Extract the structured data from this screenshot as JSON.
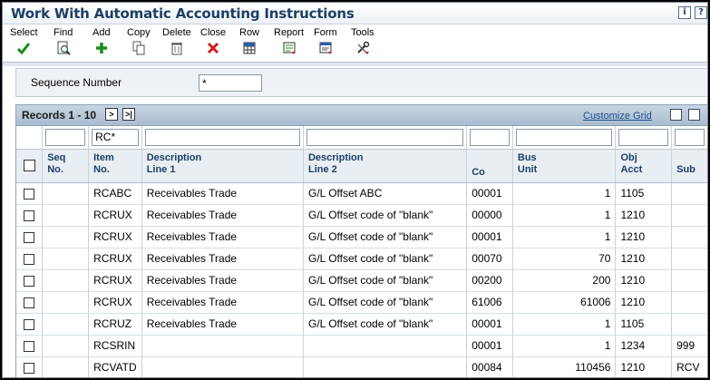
{
  "window": {
    "title": "Work With Automatic Accounting Instructions"
  },
  "toolbar": {
    "select": "Select",
    "find": "Find",
    "add": "Add",
    "copy": "Copy",
    "delete": "Delete",
    "close": "Close",
    "row": "Row",
    "report": "Report",
    "form": "Form",
    "tools": "Tools"
  },
  "colors": {
    "title": "#1d3f66",
    "link": "#1d4f91",
    "ok_green": "#1a8a1a",
    "close_red": "#d0201e"
  },
  "query": {
    "label": "Sequence Number",
    "value": "*"
  },
  "grid": {
    "records_label": "Records 1 - 10",
    "customize_label": "Customize Grid",
    "filter_values": [
      "",
      "RC*",
      "",
      "",
      "",
      "",
      "",
      ""
    ],
    "headers": {
      "seq_1": "Seq",
      "seq_2": "No.",
      "item_1": "Item",
      "item_2": "No.",
      "desc1_1": "Description",
      "desc1_2": "Line 1",
      "desc2_1": "Description",
      "desc2_2": "Line 2",
      "co": "Co",
      "bu_1": "Bus",
      "bu_2": "Unit",
      "obj_1": "Obj",
      "obj_2": "Acct",
      "sub": "Sub"
    },
    "rows": [
      {
        "seq": "",
        "item": "RCABC",
        "desc1": "Receivables Trade",
        "desc2": "G/L Offset ABC",
        "co": "00001",
        "bu": "1",
        "obj": "1105",
        "sub": ""
      },
      {
        "seq": "",
        "item": "RCRUX",
        "desc1": "Receivables Trade",
        "desc2": "G/L Offset code of \"blank\"",
        "co": "00000",
        "bu": "1",
        "obj": "1210",
        "sub": ""
      },
      {
        "seq": "",
        "item": "RCRUX",
        "desc1": "Receivables Trade",
        "desc2": "G/L Offset code of \"blank\"",
        "co": "00001",
        "bu": "1",
        "obj": "1210",
        "sub": ""
      },
      {
        "seq": "",
        "item": "RCRUX",
        "desc1": "Receivables Trade",
        "desc2": "G/L Offset code of \"blank\"",
        "co": "00070",
        "bu": "70",
        "obj": "1210",
        "sub": ""
      },
      {
        "seq": "",
        "item": "RCRUX",
        "desc1": "Receivables Trade",
        "desc2": "G/L Offset code of \"blank\"",
        "co": "00200",
        "bu": "200",
        "obj": "1210",
        "sub": ""
      },
      {
        "seq": "",
        "item": "RCRUX",
        "desc1": "Receivables Trade",
        "desc2": "G/L Offset code of \"blank\"",
        "co": "61006",
        "bu": "61006",
        "obj": "1210",
        "sub": ""
      },
      {
        "seq": "",
        "item": "RCRUZ",
        "desc1": "Receivables Trade",
        "desc2": "G/L Offset code of \"blank\"",
        "co": "00001",
        "bu": "1",
        "obj": "1105",
        "sub": ""
      },
      {
        "seq": "",
        "item": "RCSRIN",
        "desc1": "",
        "desc2": "",
        "co": "00001",
        "bu": "1",
        "obj": "1234",
        "sub": "999"
      },
      {
        "seq": "",
        "item": "RCVATD",
        "desc1": "",
        "desc2": "",
        "co": "00084",
        "bu": "110456",
        "obj": "1210",
        "sub": "RCV"
      }
    ]
  }
}
